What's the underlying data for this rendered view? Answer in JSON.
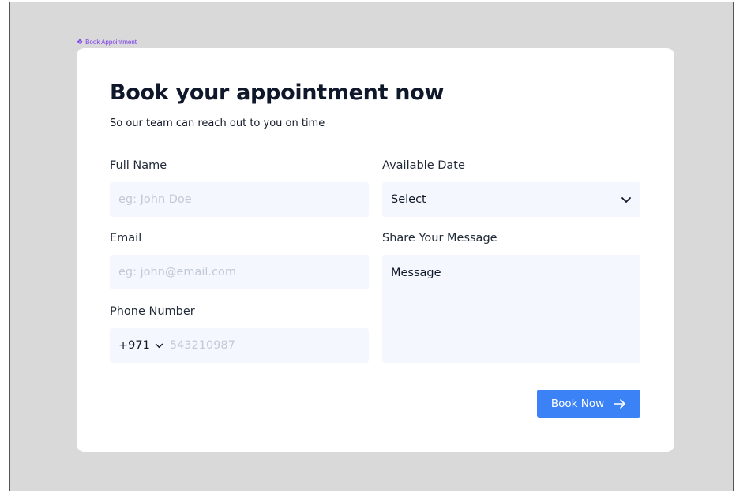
{
  "frame": {
    "label": "Book Appointment"
  },
  "form": {
    "title": "Book your appointment now",
    "subtitle": "So our team can reach out to you on time",
    "full_name": {
      "label": "Full Name",
      "placeholder": "eg: John Doe"
    },
    "email": {
      "label": "Email",
      "placeholder": "eg: john@email.com"
    },
    "phone": {
      "label": "Phone Number",
      "country_code": "+971",
      "placeholder": "543210987"
    },
    "date": {
      "label": "Available Date",
      "selected": "Select"
    },
    "message": {
      "label": "Share Your Message",
      "placeholder": "Message"
    },
    "submit_label": "Book Now"
  },
  "colors": {
    "accent": "#3b82f6",
    "frame_label": "#7c3aed",
    "field_bg": "#f4f7fd"
  },
  "icons": {
    "frame": "component-diamond-icon",
    "select": "chevron-down-icon",
    "submit": "arrow-right-icon"
  }
}
